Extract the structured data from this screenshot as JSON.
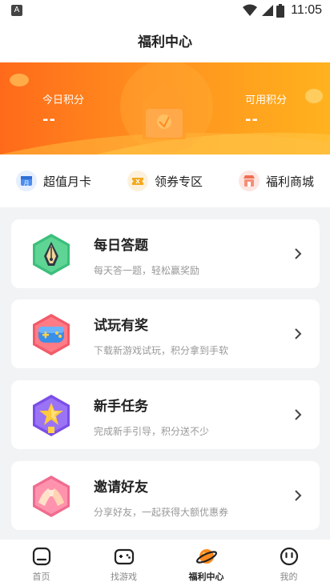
{
  "status_bar": {
    "time": "11:05",
    "notification_icon": "A"
  },
  "header": {
    "title": "福利中心"
  },
  "banner": {
    "today_points": {
      "label": "今日积分",
      "value": "--"
    },
    "available_points": {
      "label": "可用积分",
      "value": "--"
    }
  },
  "quick_nav": [
    {
      "label": "超值月卡",
      "icon": "month-card-icon",
      "color": "#4a8df0"
    },
    {
      "label": "领券专区",
      "icon": "coupon-icon",
      "color": "#f3a81e"
    },
    {
      "label": "福利商城",
      "icon": "store-icon",
      "color": "#ee6f54"
    }
  ],
  "tasks": [
    {
      "title": "每日答题",
      "subtitle": "每天答一题，轻松赢奖励",
      "icon": "pen-nib-icon",
      "color": "#3dbf7c"
    },
    {
      "title": "试玩有奖",
      "subtitle": "下载新游戏试玩，积分拿到手软",
      "icon": "gamepad-icon",
      "color": "#f35b6a"
    },
    {
      "title": "新手任务",
      "subtitle": "完成新手引导，积分送不少",
      "icon": "star-medal-icon",
      "color": "#7b4ee8"
    },
    {
      "title": "邀请好友",
      "subtitle": "分享好友，一起获得大额优惠券",
      "icon": "handshake-icon",
      "color": "#f06c8f"
    }
  ],
  "tab_bar": [
    {
      "label": "首页",
      "icon": "home-icon",
      "active": false
    },
    {
      "label": "找游戏",
      "icon": "find-game-icon",
      "active": false
    },
    {
      "label": "福利中心",
      "icon": "welfare-planet-icon",
      "active": true
    },
    {
      "label": "我的",
      "icon": "profile-icon",
      "active": false
    }
  ],
  "colors": {
    "accent": "#ff7a1a",
    "banner_start": "#ff6a1a",
    "banner_end": "#ffb21e"
  }
}
